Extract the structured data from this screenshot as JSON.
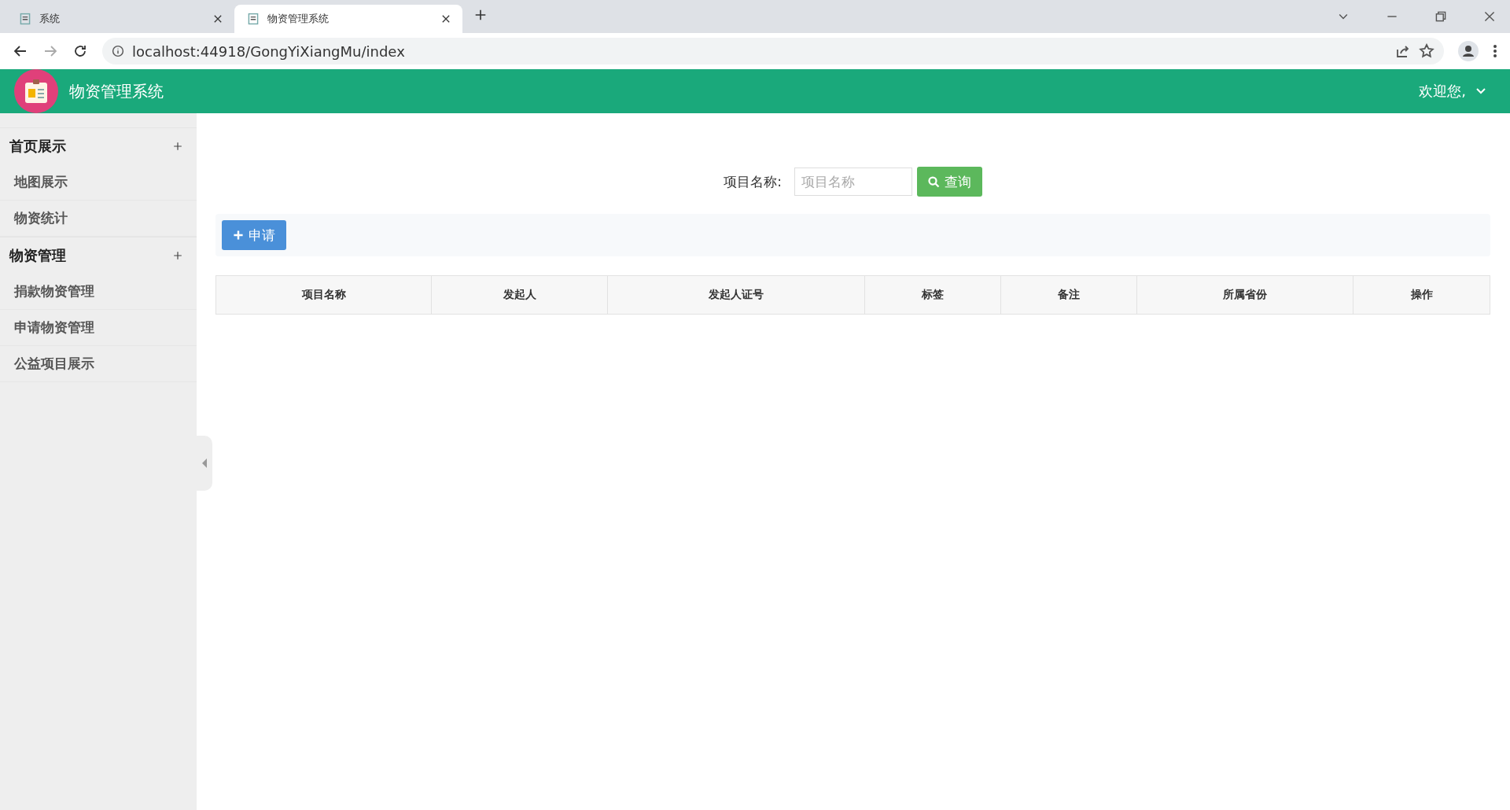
{
  "browser": {
    "tabs": [
      {
        "title": "系统",
        "selected": false
      },
      {
        "title": "物资管理系统",
        "selected": true
      }
    ],
    "address": "localhost:44918/GongYiXiangMu/index"
  },
  "header": {
    "title": "物资管理系统",
    "user": "欢迎您,"
  },
  "sidebar": {
    "groups": [
      {
        "title": "首页展示",
        "items": [
          "地图展示",
          "物资统计"
        ]
      },
      {
        "title": "物资管理",
        "items": [
          "捐款物资管理",
          "申请物资管理",
          "公益项目展示"
        ]
      }
    ]
  },
  "search": {
    "label": "项目名称:",
    "placeholder": "项目名称",
    "button": "查询"
  },
  "toolbar": {
    "add_button": "申请"
  },
  "table": {
    "columns": [
      "项目名称",
      "发起人",
      "发起人证号",
      "标签",
      "备注",
      "所属省份",
      "操作"
    ]
  }
}
